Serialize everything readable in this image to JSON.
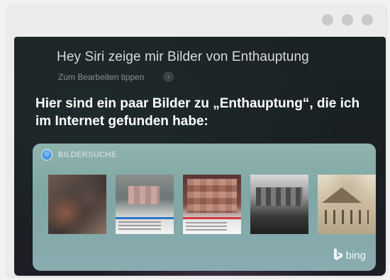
{
  "window": {
    "controls": [
      "dot",
      "dot",
      "dot"
    ]
  },
  "siri": {
    "query": "Hey Siri zeige mir Bilder von Enthauptung",
    "edit_hint": "Zum Bearbeiten tippen",
    "answer": "Hier sind ein paar Bilder zu „Enthauptung“, die ich im Internet gefunden habe:"
  },
  "card": {
    "title": "BILDERSUCHE",
    "provider": "bing",
    "icon": "safari-icon",
    "thumbnails": [
      "image-1",
      "image-2",
      "image-3",
      "image-4",
      "image-5"
    ]
  },
  "colors": {
    "siri_background": "#1b2224",
    "card_background": "#8fb3ad",
    "window_dots": "#c9c9c9"
  }
}
